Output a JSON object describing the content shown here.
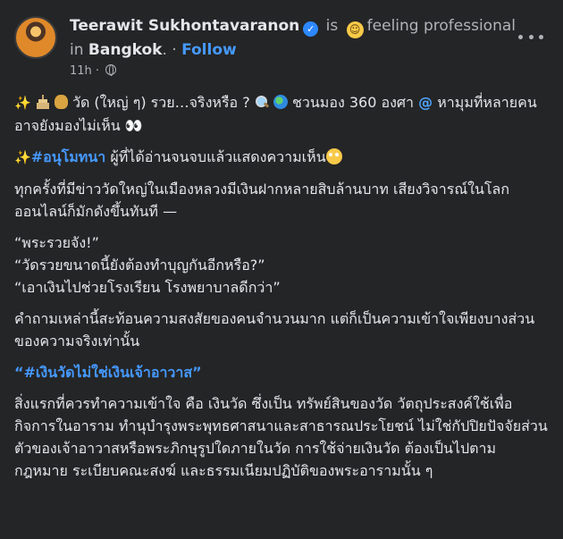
{
  "post": {
    "author_name": "Teerawit Sukhontavaranon",
    "connector_is": "is",
    "feeling": "feeling professional",
    "in_word": "in",
    "location": "Bangkok",
    "location_suffix": ".",
    "separator": "·",
    "follow_label": "Follow",
    "timestamp": "11h",
    "separator_meta": "·"
  },
  "body": {
    "line1_text": "วัด (ใหญ่ ๆ) รวย…จริงหรือ ?",
    "line1_rest": "ชวนมอง 360 องศา",
    "line1_end": "หามุมที่หลายคนอาจยังมองไม่เห็น",
    "eyes": "👀",
    "hashtag1": "#อนุโมทนา",
    "hashtag1_rest": "ผู้ที่ได้อ่านจนจบแล้วแสดงความเห็น",
    "para2": "ทุกครั้งที่มีข่าววัดใหญ่ในเมืองหลวงมีเงินฝากหลายสิบล้านบาท เสียงวิจารณ์ในโลกออนไลน์ก็มักดังขึ้นทันที —",
    "quote1": "“พระรวยจัง!”",
    "quote2": "“วัดรวยขนาดนี้ยังต้องทำบุญกันอีกหรือ?”",
    "quote3": "“เอาเงินไปช่วยโรงเรียน โรงพยาบาลดีกว่า”",
    "para3": "คำถามเหล่านี้สะท้อนความสงสัยของคนจำนวนมาก แต่ก็เป็นความเข้าใจเพียงบางส่วนของความจริงเท่านั้น",
    "hashtag2": "“#เงินวัดไม่ใช่เงินเจ้าอาวาส”",
    "para4": "สิ่งแรกที่ควรทำความเข้าใจ คือ เงินวัด ซึ่งเป็น ทรัพย์สินของวัด วัตถุประสงค์ใช้เพื่อกิจการในอาราม ทำนุบำรุงพระพุทธศาสนาและสาธารณประโยชน์ ไม่ใช่กัปปิยปัจจัยส่วนตัวของเจ้าอาวาสหรือพระภิกษุรูปใดภายในวัด การใช้จ่ายเงินวัด ต้องเป็นไปตามกฎหมาย ระเบียบคณะสงฆ์ และธรรมเนียมปฏิบัติของพระอารามนั้น ๆ"
  },
  "colors": {
    "background": "#242526",
    "text": "#e4e6eb",
    "muted": "#b0b3b8",
    "link": "#4599ff",
    "verified": "#2d88ff"
  },
  "icons": [
    "avatar",
    "verified-badge-icon",
    "smile-emoji-icon",
    "globe-icon",
    "more-options-icon",
    "sparkles-icon",
    "temple-icon",
    "money-bag-icon",
    "magnifier-icon",
    "globe-emoji-icon",
    "spiral-icon",
    "eyes-icon",
    "flushed-face-icon"
  ]
}
